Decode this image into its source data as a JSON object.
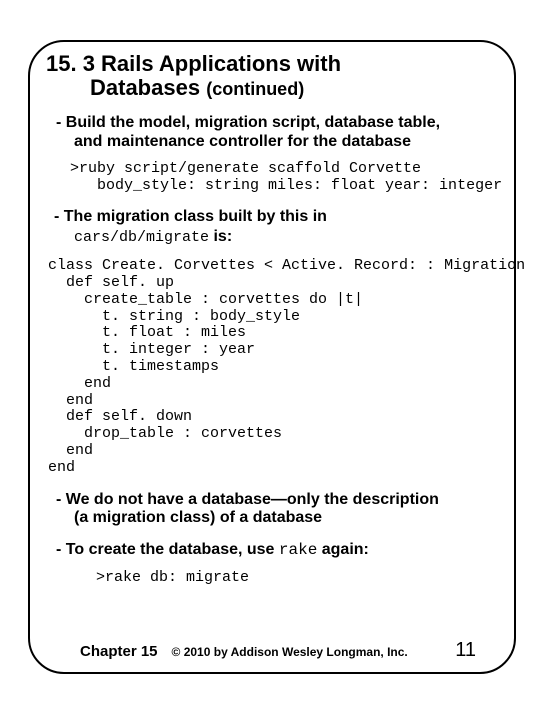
{
  "title_line1": "15. 3 Rails Applications with",
  "title_line2": "Databases",
  "title_cont": "(continued)",
  "bullet_build_1": "- Build the model, migration script, database table,",
  "bullet_build_2": "and maintenance controller for the database",
  "code_scaffold_1": ">ruby script/generate scaffold Corvette",
  "code_scaffold_2": "   body_style: string miles: float year: integer",
  "mig_line": "- The migration class built by this in",
  "mig_path": "cars/db/migrate",
  "mig_is": "is:",
  "classcode": "class Create. Corvettes < Active. Record: : Migration\n  def self. up\n    create_table : corvettes do |t|\n      t. string : body_style\n      t. float : miles\n      t. integer : year\n      t. timestamps\n    end\n  end\n  def self. down\n    drop_table : corvettes\n  end\nend",
  "bullet_nodb_1": "- We do not have a database—only the description",
  "bullet_nodb_2": "(a migration class) of a database",
  "bullet_create_1": "- To create the database, use ",
  "bullet_create_rake": "rake",
  "bullet_create_2": " again:",
  "code_rake": ">rake db: migrate",
  "footer_chapter": "Chapter 15",
  "footer_copy": "© 2010 by Addison Wesley Longman, Inc.",
  "footer_page": "11"
}
